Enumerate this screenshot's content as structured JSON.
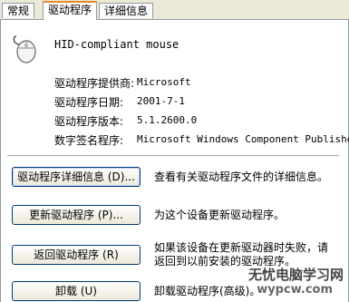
{
  "tabs": [
    "常规",
    "驱动程序",
    "详细信息"
  ],
  "device": {
    "name": "HID-compliant mouse",
    "icon": "mouse-icon"
  },
  "info": [
    {
      "label": "驱动程序提供商:",
      "value": "Microsoft"
    },
    {
      "label": "驱动程序日期:",
      "value": "2001-7-1"
    },
    {
      "label": "驱动程序版本:",
      "value": "5.1.2600.0"
    },
    {
      "label": "数字签名程序:",
      "value": "Microsoft Windows Component Publisher"
    }
  ],
  "actions": [
    {
      "button": "驱动程序详细信息 (D)...",
      "desc": "查看有关驱动程序文件的详细信息。"
    },
    {
      "button": "更新驱动程序 (P)...",
      "desc": "为这个设备更新驱动程序。"
    },
    {
      "button": "返回驱动程序 (R)",
      "desc": "如果该设备在更新驱动器时失败，请",
      "desc2": "返回到以前安装的驱动程序。"
    },
    {
      "button": "卸载 (U)",
      "desc": "卸载驱动程序(高级)。"
    }
  ],
  "watermark": {
    "line1": "无忧电脑学习网",
    "line2": "wypcw.com"
  }
}
